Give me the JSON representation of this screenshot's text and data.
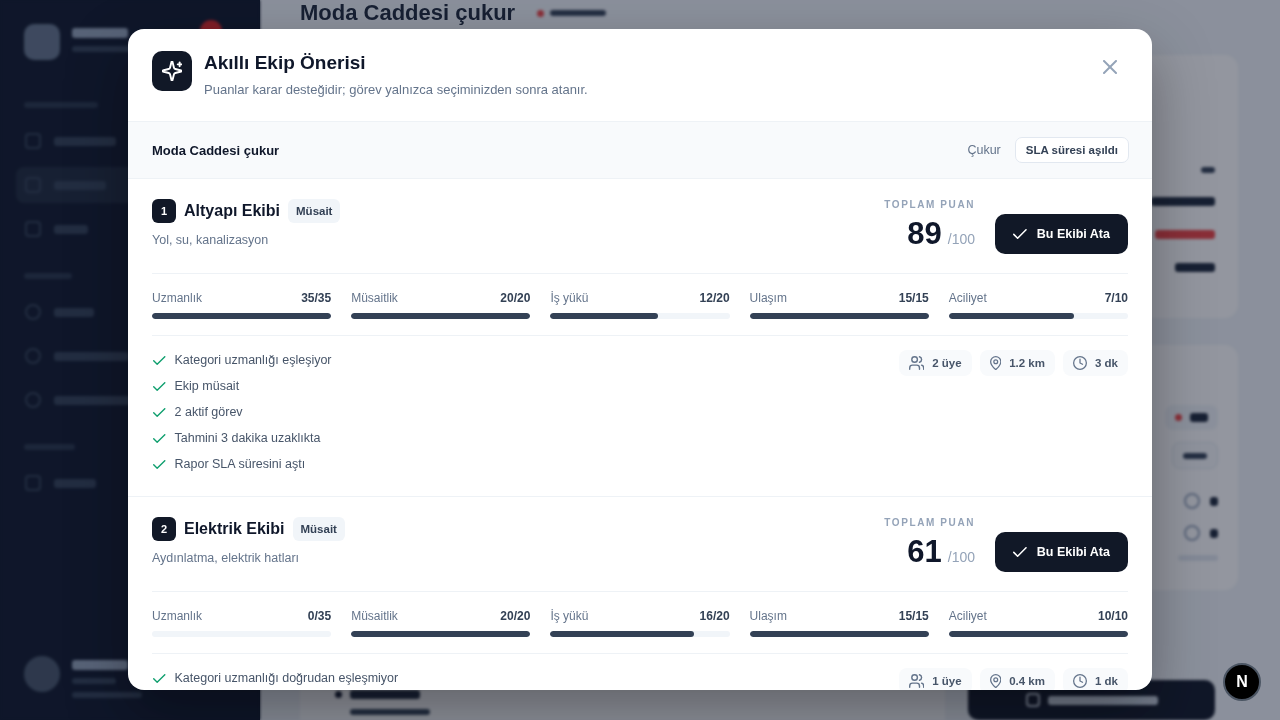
{
  "report_page": {
    "title": "Moda Caddesi çukur"
  },
  "dialog": {
    "title": "Akıllı Ekip Önerisi",
    "subtitle": "Puanlar karar desteğidir; görev yalnızca seçiminizden sonra atanır.",
    "report": {
      "title": "Moda Caddesi çukur",
      "category": "Çukur",
      "tag": "SLA süresi aşıldı"
    },
    "teams": [
      {
        "rank": "1",
        "name": "Altyapı Ekibi",
        "availability": "Müsait",
        "description": "Yol, su, kanalizasyon",
        "score_label": "TOPLAM PUAN",
        "score": "89",
        "score_max": "/100",
        "action": "Bu Ekibi Ata",
        "metrics": [
          {
            "label": "Uzmanlık",
            "value": "35/35",
            "level": 1
          },
          {
            "label": "Müsaitlik",
            "value": "20/20",
            "level": 1
          },
          {
            "label": "İş yükü",
            "value": "12/20",
            "level": 0.6
          },
          {
            "label": "Ulaşım",
            "value": "15/15",
            "level": 1
          },
          {
            "label": "Aciliyet",
            "value": "7/10",
            "level": 0.7
          }
        ],
        "reasons": [
          "Kategori uzmanlığı eşleşiyor",
          "Ekip müsait",
          "2 aktif görev",
          "Tahmini 3 dakika uzaklıkta",
          "Rapor SLA süresini aştı"
        ],
        "facts": [
          "2 üye",
          "1.2 km",
          "3 dk"
        ]
      },
      {
        "rank": "2",
        "name": "Elektrik Ekibi",
        "availability": "Müsait",
        "description": "Aydınlatma, elektrik hatları",
        "score_label": "TOPLAM PUAN",
        "score": "61",
        "score_max": "/100",
        "action": "Bu Ekibi Ata",
        "metrics": [
          {
            "label": "Uzmanlık",
            "value": "0/35",
            "level": 0
          },
          {
            "label": "Müsaitlik",
            "value": "20/20",
            "level": 1
          },
          {
            "label": "İş yükü",
            "value": "16/20",
            "level": 0.8
          },
          {
            "label": "Ulaşım",
            "value": "15/15",
            "level": 1
          },
          {
            "label": "Aciliyet",
            "value": "10/10",
            "level": 1
          }
        ],
        "reasons": [
          "Kategori uzmanlığı doğrudan eşleşmiyor"
        ],
        "facts": [
          "1 üye",
          "0.4 km",
          "1 dk"
        ]
      }
    ]
  },
  "dev_tools": {
    "label": "N"
  }
}
